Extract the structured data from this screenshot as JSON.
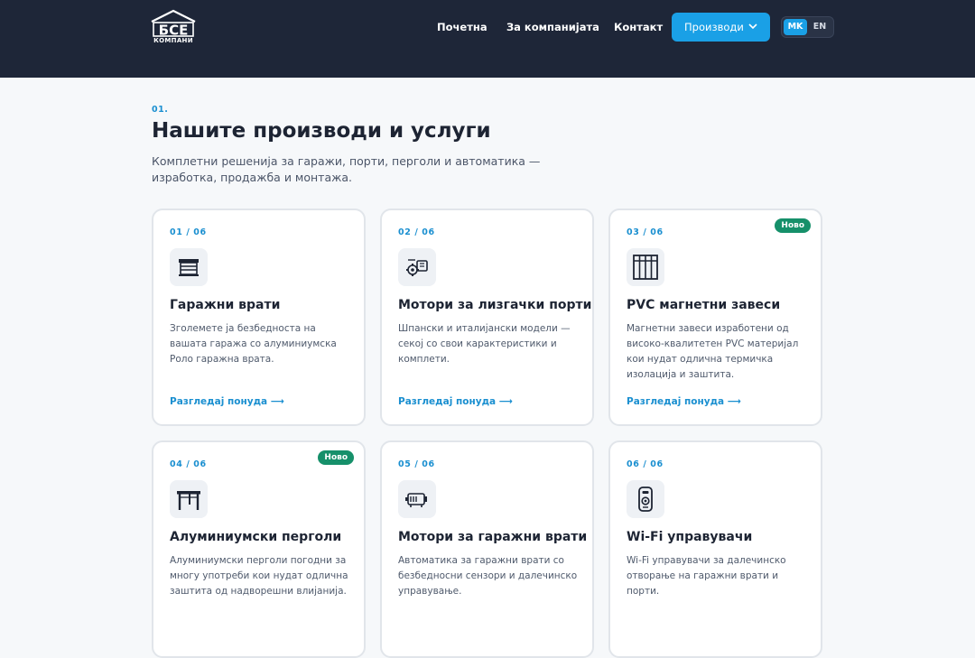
{
  "header": {
    "logo_sub": "КОМПАНИ",
    "nav": [
      {
        "label": "Почетна"
      },
      {
        "label": "За компанијата"
      },
      {
        "label": "Контакт"
      }
    ],
    "products_label": "Производи",
    "lang": {
      "mk": "MK",
      "en": "EN"
    },
    "colors": {
      "bar": "#1e2638",
      "accent": "#1aa0e6"
    }
  },
  "section": {
    "number": "01.",
    "title": "Нашите производи и услуги",
    "description": "Комплетни решенија за гаражи, порти, перголи и автоматика — изработка, продажба и монтажа."
  },
  "cards": [
    {
      "index": "01 / 06",
      "icon": "garage-door-icon",
      "title": "Гаражни врати",
      "description": "Зголемете ја безбедноста на вашата гаража со алуминиумска Роло гаражна врата.",
      "link": "Разгледај понуда ⟶",
      "badge": ""
    },
    {
      "index": "02 / 06",
      "icon": "gear-motor-icon",
      "title": "Мотори за лизгачки порти",
      "description": "Шпански и италијански модели — секој со свои карактеристики и комплети.",
      "link": "Разгледај понуда ⟶",
      "badge": ""
    },
    {
      "index": "03 / 06",
      "icon": "curtain-grid-icon",
      "title": "PVC магнетни завеси",
      "description": "Магнетни завеси изработени од високо-квалитетен PVC материјал кои нудат одлична термичка изолација и заштита.",
      "link": "Разгледај понуда ⟶",
      "badge": "Ново"
    },
    {
      "index": "04 / 06",
      "icon": "pergola-icon",
      "title": "Алуминиумски перголи",
      "description": "Алуминиумски перголи погодни за многу употреби кои нудат одлична заштита од надворешни влијанија.",
      "link": "",
      "badge": "Ново"
    },
    {
      "index": "05 / 06",
      "icon": "motor-icon",
      "title": "Мотори за гаражни врати",
      "description": "Автоматика за гаражни врати со безбедносни сензори и далечинско управување.",
      "link": "",
      "badge": ""
    },
    {
      "index": "06 / 06",
      "icon": "remote-control-icon",
      "title": "Wi-Fi управувачи",
      "description": "Wi-Fi управувачи за далечинско отворање на гаражни врати и порти.",
      "link": "",
      "badge": ""
    }
  ],
  "colors": {
    "accent_text": "#1a8fd0",
    "badge": "#16906a",
    "card_border": "#e1e5ea"
  }
}
